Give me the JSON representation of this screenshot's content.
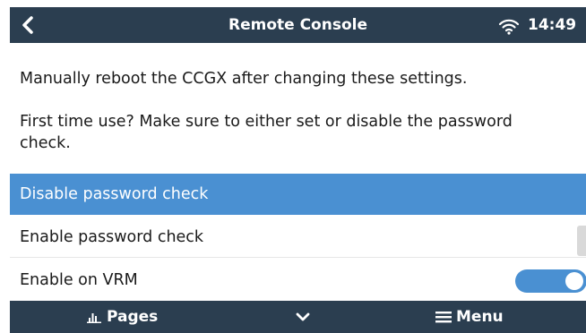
{
  "header": {
    "title": "Remote Console",
    "time": "14:49",
    "back_icon": "back-chevron-icon",
    "wifi_icon": "wifi-icon"
  },
  "messages": {
    "reboot_notice": "Manually reboot the CCGX after changing these settings.",
    "first_time_notice": "First time use? Make sure to either set or disable the password check."
  },
  "menu": {
    "items": [
      {
        "label": "Disable password check",
        "selected": true
      },
      {
        "label": "Enable password check",
        "selected": false
      },
      {
        "label": "Enable on VRM",
        "selected": false,
        "toggle_on": true
      }
    ]
  },
  "footer": {
    "pages_label": "Pages",
    "menu_label": "Menu",
    "pages_icon": "bar-chart-icon",
    "down_icon": "chevron-down-icon",
    "menu_icon": "hamburger-icon"
  },
  "colors": {
    "bar_background": "#2b3e50",
    "accent": "#4a90d2"
  }
}
